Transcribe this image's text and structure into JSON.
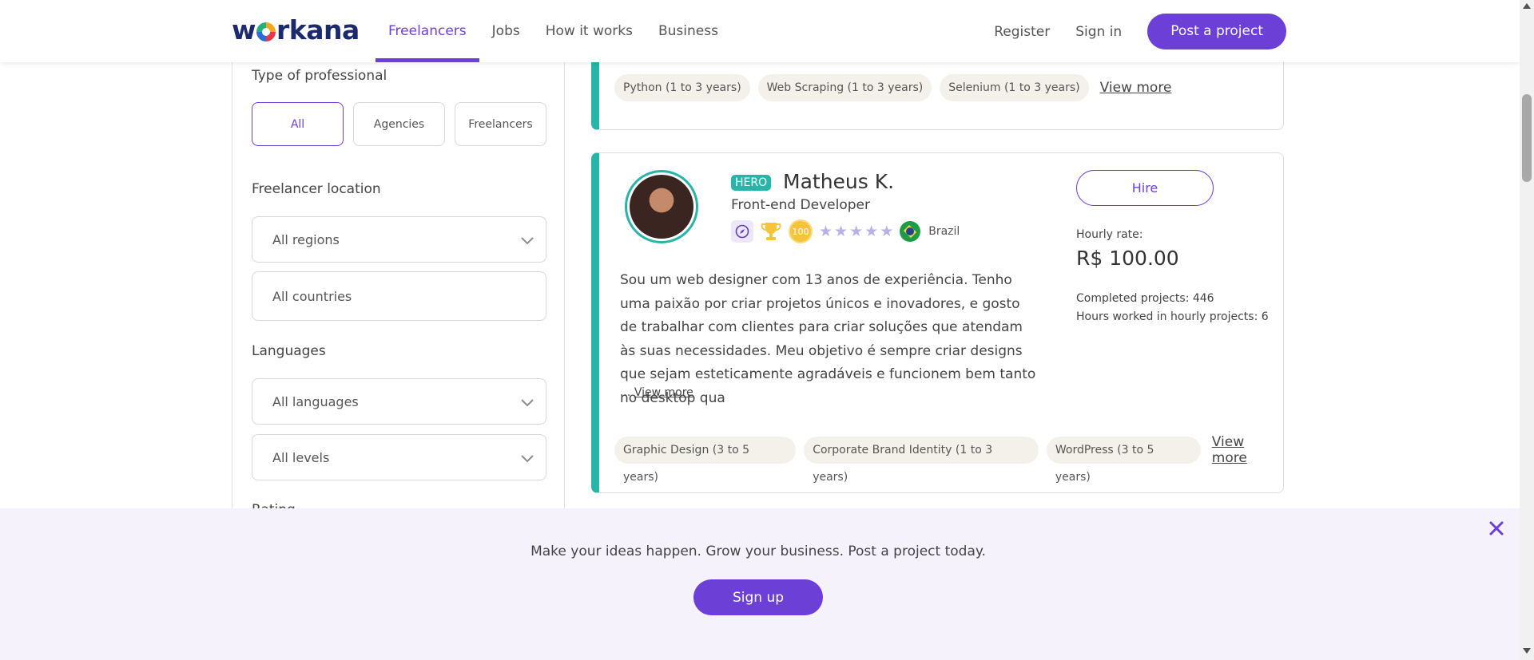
{
  "header": {
    "logo_text_left": "w",
    "logo_text_right": "rkana",
    "nav": [
      "Freelancers",
      "Jobs",
      "How it works",
      "Business"
    ],
    "active_nav": "Freelancers",
    "register": "Register",
    "sign_in": "Sign in",
    "post_project": "Post a project"
  },
  "sidebar": {
    "type_label": "Type of professional",
    "type_options": [
      "All",
      "Agencies",
      "Freelancers"
    ],
    "location_label": "Freelancer location",
    "region_value": "All regions",
    "country_value": "All countries",
    "languages_label": "Languages",
    "language_value": "All languages",
    "level_value": "All levels",
    "rating_label": "Rating"
  },
  "prev_card": {
    "tags": [
      "Python (1 to 3 years)",
      "Web Scraping (1 to 3 years)",
      "Selenium (1 to 3 years)"
    ],
    "view_more": "View more"
  },
  "card": {
    "badge": "HERO",
    "name": "Matheus K.",
    "role": "Front-end Developer",
    "badge_100": "100",
    "country": "Brazil",
    "description": "Sou um web designer com 13 anos de experiência. Tenho uma paixão por criar projetos únicos e inovadores, e gosto de trabalhar com clientes para criar soluções que atendam às suas necessidades. Meu objetivo é sempre criar designs que sejam esteticamente agradáveis e funcionem bem tanto no desktop qua",
    "ellipsis": "...",
    "desc_view_more": "View more",
    "hire": "Hire",
    "rate_label": "Hourly rate:",
    "rate": "R$ 100.00",
    "completed": "Completed projects: 446",
    "hours": "Hours worked in hourly projects: 6",
    "tags": [
      "Graphic Design (3 to 5 years)",
      "Corporate Brand Identity (1 to 3 years)",
      "WordPress (3 to 5 years)"
    ],
    "tags_view_more": "View more"
  },
  "banner": {
    "text": "Make your ideas happen. Grow your business. Post a project today.",
    "button": "Sign up"
  },
  "colors": {
    "accent": "#6c3fd6",
    "teal": "#26b5a8",
    "banner_bg": "#f5f2fc"
  }
}
